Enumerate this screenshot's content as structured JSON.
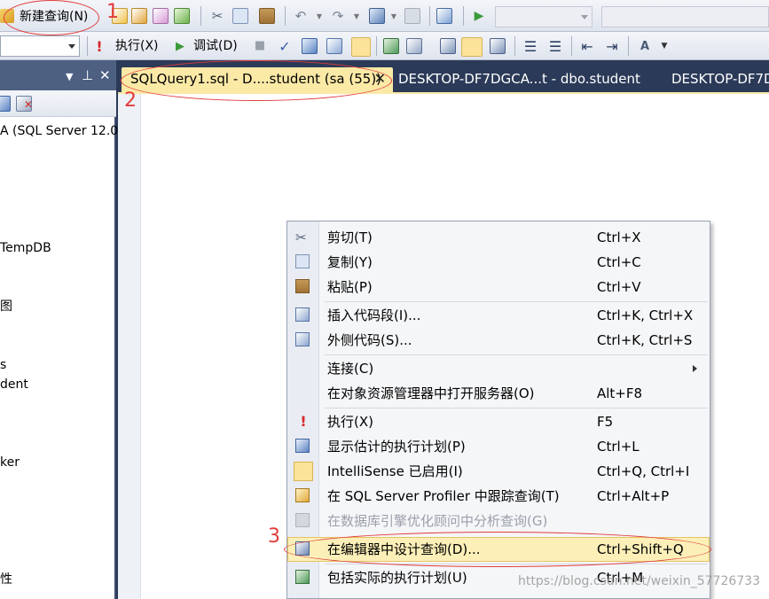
{
  "toolbar1": {
    "new_query_label": "新建查询(N)"
  },
  "toolbar2": {
    "execute_label": "执行(X)",
    "debug_label": "调试(D)"
  },
  "object_explorer": {
    "items": [
      {
        "label": "A (SQL Server 12.0"
      },
      {
        "label": "TempDB"
      },
      {
        "label": "图"
      },
      {
        "label": "s"
      },
      {
        "label": "dent"
      },
      {
        "label": "ker"
      },
      {
        "label": "性"
      }
    ]
  },
  "tabs": [
    {
      "label": "SQLQuery1.sql - D....student (sa (55))",
      "close": "✕"
    },
    {
      "label": "DESKTOP-DF7DGCA...t - dbo.student"
    },
    {
      "label": "DESKTOP-DF7D"
    }
  ],
  "context_menu": {
    "items": [
      {
        "label": "剪切(T)",
        "shortcut": "Ctrl+X",
        "icon": "scissors-icon"
      },
      {
        "label": "复制(Y)",
        "shortcut": "Ctrl+C",
        "icon": "copy-icon"
      },
      {
        "label": "粘贴(P)",
        "shortcut": "Ctrl+V",
        "icon": "paste-icon"
      },
      {
        "label": "插入代码段(I)...",
        "shortcut": "Ctrl+K, Ctrl+X",
        "icon": "insert-snippet-icon"
      },
      {
        "label": "外侧代码(S)...",
        "shortcut": "Ctrl+K, Ctrl+S",
        "icon": "surround-with-icon"
      },
      {
        "label": "连接(C)",
        "shortcut": "",
        "icon": ""
      },
      {
        "label": "在对象资源管理器中打开服务器(O)",
        "shortcut": "Alt+F8",
        "icon": ""
      },
      {
        "label": "执行(X)",
        "shortcut": "F5",
        "icon": "execute-icon"
      },
      {
        "label": "显示估计的执行计划(P)",
        "shortcut": "Ctrl+L",
        "icon": "estimated-plan-icon"
      },
      {
        "label": "IntelliSense 已启用(I)",
        "shortcut": "Ctrl+Q, Ctrl+I",
        "icon": "intellisense-icon"
      },
      {
        "label": "在 SQL Server Profiler 中跟踪查询(T)",
        "shortcut": "Ctrl+Alt+P",
        "icon": "profiler-icon"
      },
      {
        "label": "在数据库引擎优化顾问中分析查询(G)",
        "shortcut": "",
        "icon": "tuning-advisor-icon"
      },
      {
        "label": "在编辑器中设计查询(D)...",
        "shortcut": "Ctrl+Shift+Q",
        "icon": "design-query-icon"
      },
      {
        "label": "包括实际的执行计划(U)",
        "shortcut": "Ctrl+M",
        "icon": "actual-plan-icon"
      }
    ]
  },
  "annotations": {
    "n1": "1",
    "n2": "2",
    "n3": "3"
  },
  "watermark": "https://blog.csdn.net/weixin_57726733",
  "colors": {
    "accent": "#4d6082",
    "annotation": "#e23b3b",
    "active_tab": "#fbe9a6",
    "menu_highlight": "#fcefb8"
  }
}
